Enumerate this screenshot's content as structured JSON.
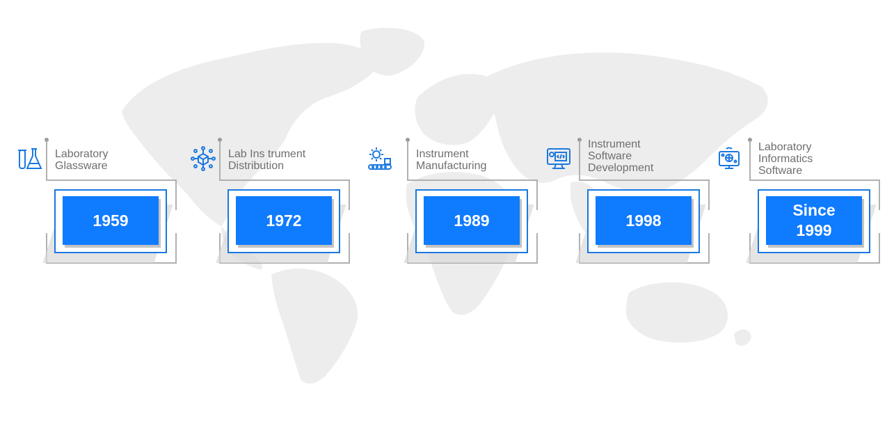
{
  "milestones": [
    {
      "label_lines": [
        "Laboratory",
        "Glassware"
      ],
      "year": "1959",
      "icon": "lab-glassware-icon"
    },
    {
      "label_lines": [
        "Lab Ins trument",
        "Distribution"
      ],
      "year": "1972",
      "icon": "distribution-network-icon"
    },
    {
      "label_lines": [
        "Instrument",
        "Manufacturing"
      ],
      "year": "1989",
      "icon": "manufacturing-gear-icon"
    },
    {
      "label_lines": [
        "Instrument",
        "Software",
        "Development"
      ],
      "year": "1998",
      "icon": "software-development-icon"
    },
    {
      "label_lines": [
        "Laboratory",
        "Informatics",
        "Software"
      ],
      "year": "Since 1999",
      "icon": "informatics-icon"
    }
  ],
  "colors": {
    "accent": "#0f7bff",
    "border": "#1a78e0",
    "line": "#b0b0b0",
    "text": "#6e6e6e",
    "map": "#ededed"
  }
}
